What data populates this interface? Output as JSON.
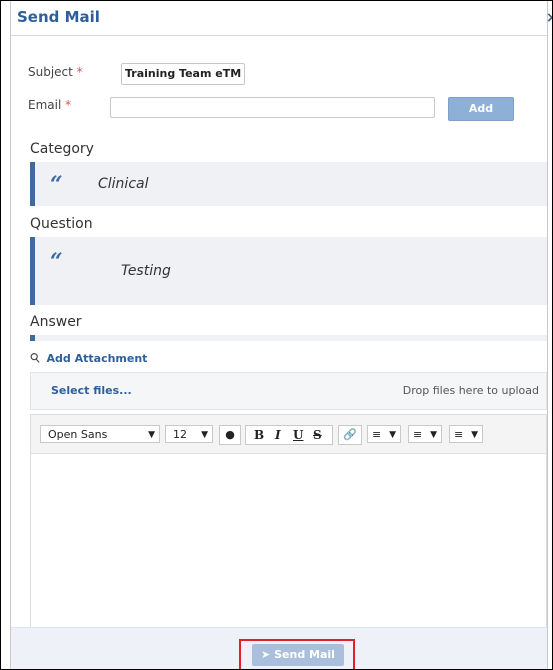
{
  "dialog": {
    "title": "Send Mail",
    "close_glyph": "×"
  },
  "form": {
    "subject_label": "Subject",
    "subject_value": "Training Team eTM",
    "email_label": "Email",
    "email_value": "",
    "required_mark": "*",
    "add_label": "Add"
  },
  "sections": {
    "category_title": "Category",
    "category_quote_mark": "“",
    "category_value": "Clinical",
    "question_title": "Question",
    "question_quote_mark": "“",
    "question_value": "Testing",
    "answer_title": "Answer"
  },
  "attachments": {
    "add_label": "Add Attachment",
    "select_label": "Select files...",
    "drop_label": "Drop files here to upload"
  },
  "editor": {
    "font_family": "Open Sans",
    "font_size": "12",
    "bold": "B",
    "italic": "I",
    "underline": "U",
    "strike": "S",
    "content": ""
  },
  "footer": {
    "send_label": "Send Mail"
  },
  "colors": {
    "accent": "#2f5f9a",
    "quote_bar": "#3d6aa0",
    "highlight": "#e3202a"
  }
}
